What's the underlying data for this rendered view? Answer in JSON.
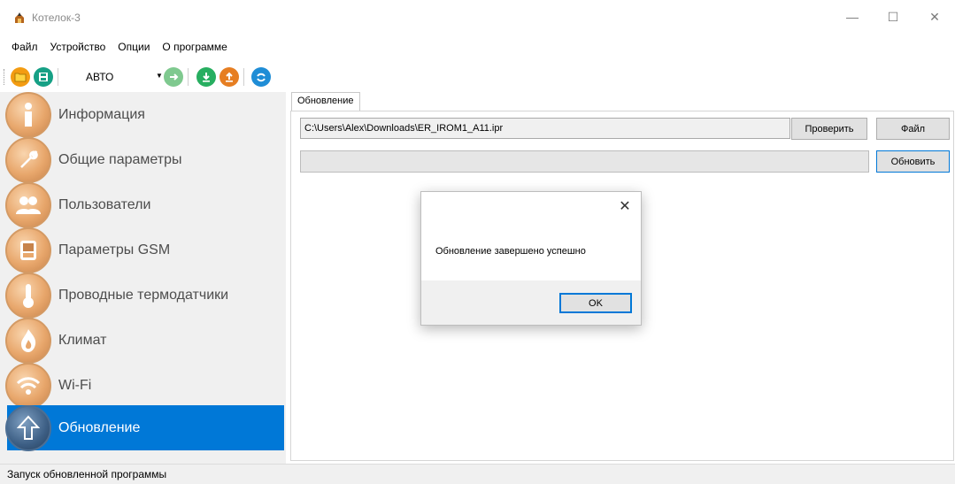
{
  "window": {
    "title": "Котелок-3",
    "minimize_glyph": "—",
    "maximize_glyph": "☐",
    "close_glyph": "✕"
  },
  "menu": [
    "Файл",
    "Устройство",
    "Опции",
    "О программе"
  ],
  "toolbar": {
    "mode_value": "АВТО",
    "icons": [
      "open-folder-icon",
      "save-icon",
      "connect-icon",
      "download-icon",
      "upload-icon",
      "sync-icon"
    ]
  },
  "sidebar": {
    "items": [
      {
        "label": "Информация",
        "icon": "info-icon",
        "active": false
      },
      {
        "label": "Общие параметры",
        "icon": "wrench-icon",
        "active": false
      },
      {
        "label": "Пользователи",
        "icon": "users-icon",
        "active": false
      },
      {
        "label": "Параметры GSM",
        "icon": "phone-icon",
        "active": false
      },
      {
        "label": "Проводные термодатчики",
        "icon": "thermometer-icon",
        "active": false
      },
      {
        "label": "Климат",
        "icon": "flame-icon",
        "active": false
      },
      {
        "label": "Wi-Fi",
        "icon": "wifi-icon",
        "active": false
      },
      {
        "label": "Обновление",
        "icon": "upload-arrow-icon",
        "active": true
      }
    ]
  },
  "main": {
    "tab_label": "Обновление",
    "file_path": "C:\\Users\\Alex\\Downloads\\ER_IROM1_A11.ipr",
    "check_button": "Проверить",
    "file_button": "Файл",
    "update_button": "Обновить",
    "progress": 0
  },
  "dialog": {
    "message": "Обновление завершено успешно",
    "ok_label": "OK",
    "close_glyph": "✕"
  },
  "status": {
    "text": "Запуск обновленной программы"
  },
  "colors": {
    "accent": "#0078d7",
    "sidebar_bg": "#f0f0f0",
    "icon_orange": "#e8a76c"
  }
}
